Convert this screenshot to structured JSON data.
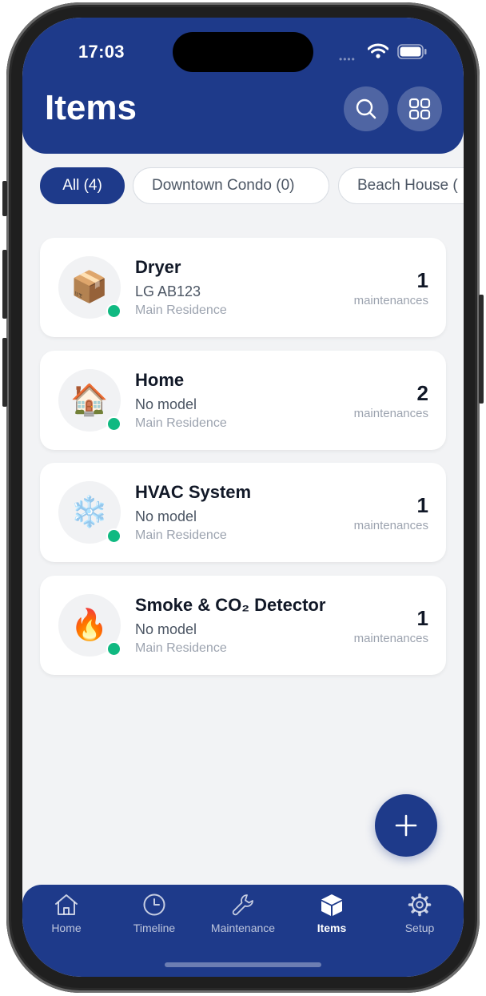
{
  "status_bar": {
    "time": "17:03",
    "signal": "••••"
  },
  "header": {
    "title": "Items"
  },
  "filters": [
    {
      "label": "All (4)",
      "active": true
    },
    {
      "label": "Downtown Condo (0)",
      "active": false
    },
    {
      "label": "Beach House (",
      "active": false
    }
  ],
  "items": [
    {
      "icon": "📦",
      "icon_name": "package-icon",
      "name": "Dryer",
      "model": "LG AB123",
      "location": "Main Residence",
      "count": "1",
      "count_label": "maintenances"
    },
    {
      "icon": "🏠",
      "icon_name": "house-icon",
      "name": "Home",
      "model": "No model",
      "location": "Main Residence",
      "count": "2",
      "count_label": "maintenances"
    },
    {
      "icon": "❄️",
      "icon_name": "snowflake-icon",
      "name": "HVAC System",
      "model": "No model",
      "location": "Main Residence",
      "count": "1",
      "count_label": "maintenances"
    },
    {
      "icon": "🔥",
      "icon_name": "fire-icon",
      "name": "Smoke & CO₂ Detector",
      "model": "No model",
      "location": "Main Residence",
      "count": "1",
      "count_label": "maintenances"
    }
  ],
  "tabs": [
    {
      "label": "Home",
      "icon": "home-icon",
      "active": false
    },
    {
      "label": "Timeline",
      "icon": "clock-icon",
      "active": false
    },
    {
      "label": "Maintenance",
      "icon": "wrench-icon",
      "active": false
    },
    {
      "label": "Items",
      "icon": "box-icon",
      "active": true
    },
    {
      "label": "Setup",
      "icon": "gear-icon",
      "active": false
    }
  ],
  "colors": {
    "primary": "#1e3a8a",
    "background": "#f2f3f5",
    "status_dot": "#10b981"
  }
}
